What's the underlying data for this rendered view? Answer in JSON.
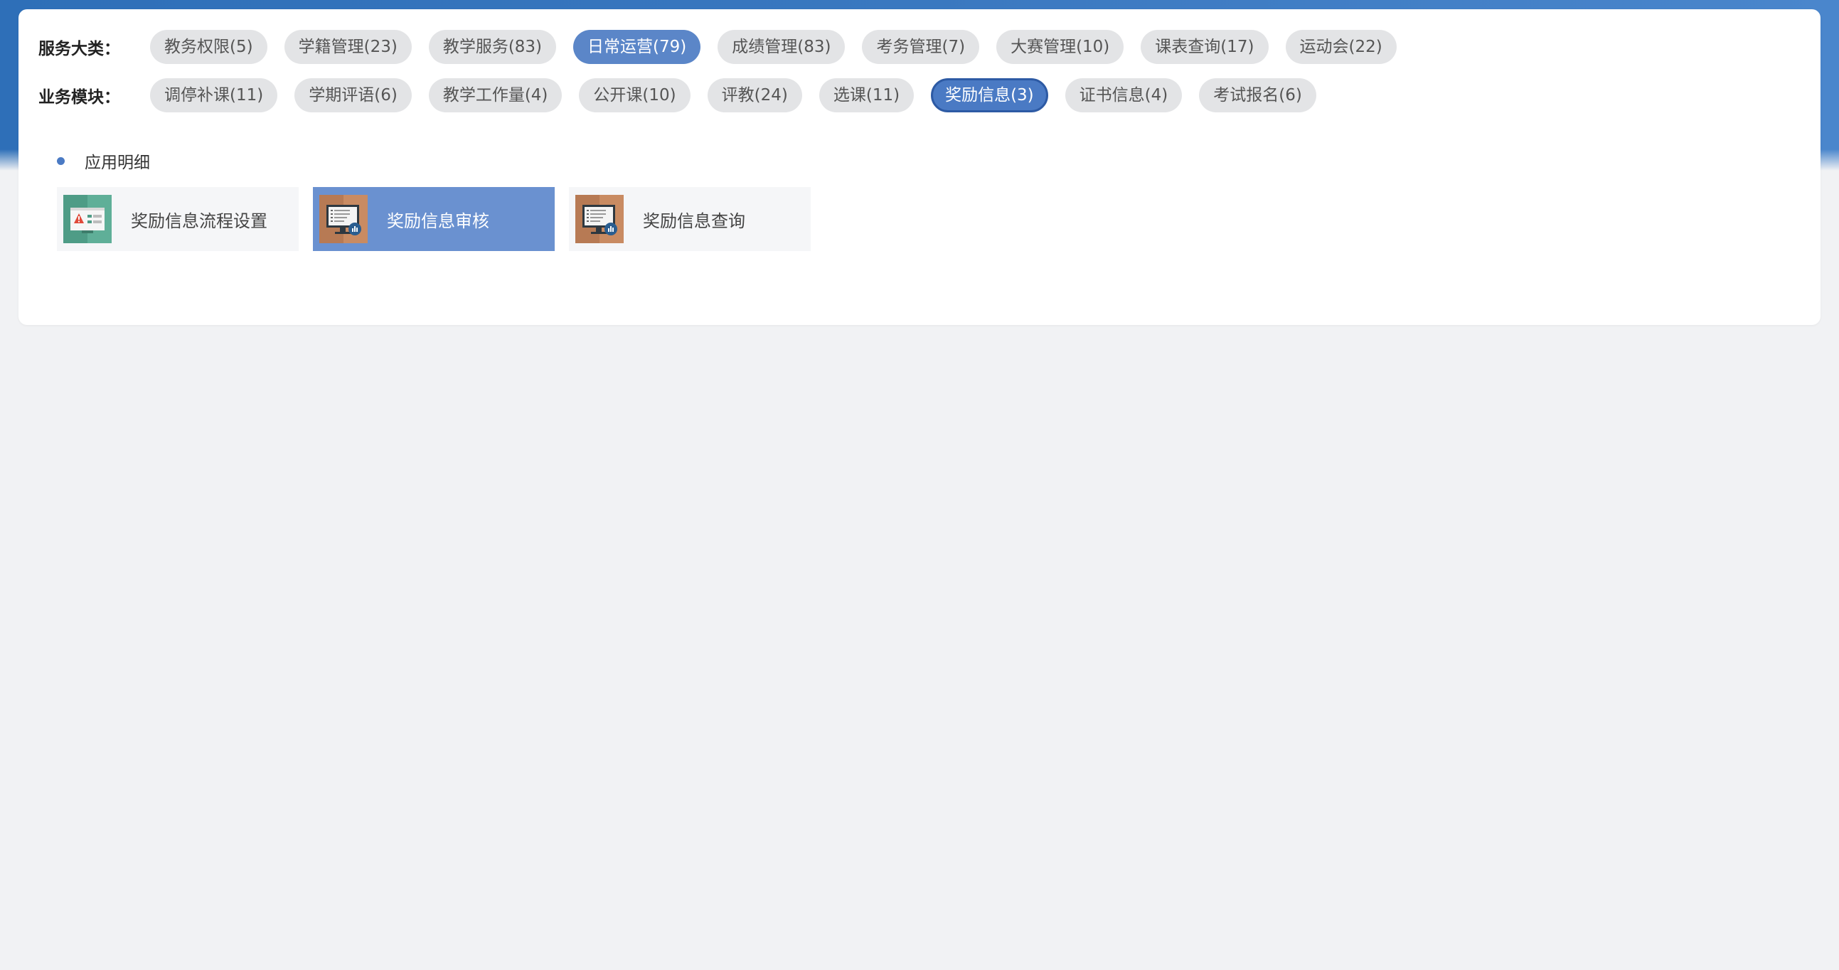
{
  "service_categories": {
    "label": "服务大类：",
    "items": [
      {
        "label": "教务权限(5)",
        "state": "default"
      },
      {
        "label": "学籍管理(23)",
        "state": "default"
      },
      {
        "label": "教学服务(83)",
        "state": "default"
      },
      {
        "label": "日常运营(79)",
        "state": "active"
      },
      {
        "label": "成绩管理(83)",
        "state": "default"
      },
      {
        "label": "考务管理(7)",
        "state": "default"
      },
      {
        "label": "大赛管理(10)",
        "state": "default"
      },
      {
        "label": "课表查询(17)",
        "state": "default"
      },
      {
        "label": "运动会(22)",
        "state": "default"
      }
    ]
  },
  "business_modules": {
    "label": "业务模块：",
    "items": [
      {
        "label": "调停补课(11)",
        "state": "default"
      },
      {
        "label": "学期评语(6)",
        "state": "default"
      },
      {
        "label": "教学工作量(4)",
        "state": "default"
      },
      {
        "label": "公开课(10)",
        "state": "default"
      },
      {
        "label": "评教(24)",
        "state": "default"
      },
      {
        "label": "选课(11)",
        "state": "default"
      },
      {
        "label": "奖励信息(3)",
        "state": "active"
      },
      {
        "label": "证书信息(4)",
        "state": "default"
      },
      {
        "label": "考试报名(6)",
        "state": "default"
      }
    ]
  },
  "app_details": {
    "title": "应用明细",
    "apps": [
      {
        "label": "奖励信息流程设置",
        "icon": "workflow-settings-icon",
        "selected": false
      },
      {
        "label": "奖励信息审核",
        "icon": "monitor-report-icon",
        "selected": true
      },
      {
        "label": "奖励信息查询",
        "icon": "monitor-report-icon",
        "selected": false
      }
    ]
  },
  "colors": {
    "header_blue": "#3a78c0",
    "active_pill": "#5b86c8",
    "selected_card": "#6a91d0",
    "page_bg": "#f1f2f4"
  }
}
